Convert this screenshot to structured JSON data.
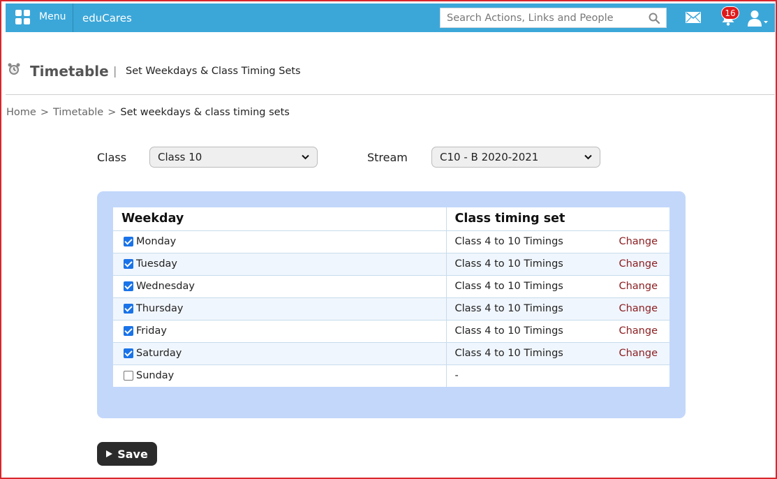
{
  "topbar": {
    "menu_label": "Menu",
    "brand": "eduCares",
    "search_placeholder": "Search Actions, Links and People",
    "notification_count": "16",
    "bar_color": "#3ba7d9"
  },
  "header": {
    "title": "Timetable",
    "separator": "|",
    "subtitle": "Set Weekdays & Class Timing Sets"
  },
  "breadcrumb": {
    "items": [
      "Home",
      "Timetable"
    ],
    "separator": ">",
    "current": "Set weekdays & class timing sets"
  },
  "filters": {
    "class_label": "Class",
    "class_value": "Class 10",
    "stream_label": "Stream",
    "stream_value": "C10 - B 2020-2021"
  },
  "table": {
    "headers": [
      "Weekday",
      "Class timing set"
    ],
    "rows": [
      {
        "day": "Monday",
        "checked": true,
        "timing": "Class 4 to 10 Timings",
        "action": "Change"
      },
      {
        "day": "Tuesday",
        "checked": true,
        "timing": "Class 4 to 10 Timings",
        "action": "Change"
      },
      {
        "day": "Wednesday",
        "checked": true,
        "timing": "Class 4 to 10 Timings",
        "action": "Change"
      },
      {
        "day": "Thursday",
        "checked": true,
        "timing": "Class 4 to 10 Timings",
        "action": "Change"
      },
      {
        "day": "Friday",
        "checked": true,
        "timing": "Class 4 to 10 Timings",
        "action": "Change"
      },
      {
        "day": "Saturday",
        "checked": true,
        "timing": "Class 4 to 10 Timings",
        "action": "Change"
      },
      {
        "day": "Sunday",
        "checked": false,
        "timing": "-",
        "action": ""
      }
    ]
  },
  "actions": {
    "save_label": "Save"
  },
  "colors": {
    "accent": "#3ba7d9",
    "panel": "#c2d7fa",
    "change_link": "#8b1f22",
    "badge": "#e0191b"
  },
  "icons": {
    "menu": "grid-icon",
    "search": "search-icon",
    "mail": "mail-icon",
    "notifications": "bell-icon",
    "user": "user-icon",
    "page": "alarm-clock-icon"
  }
}
